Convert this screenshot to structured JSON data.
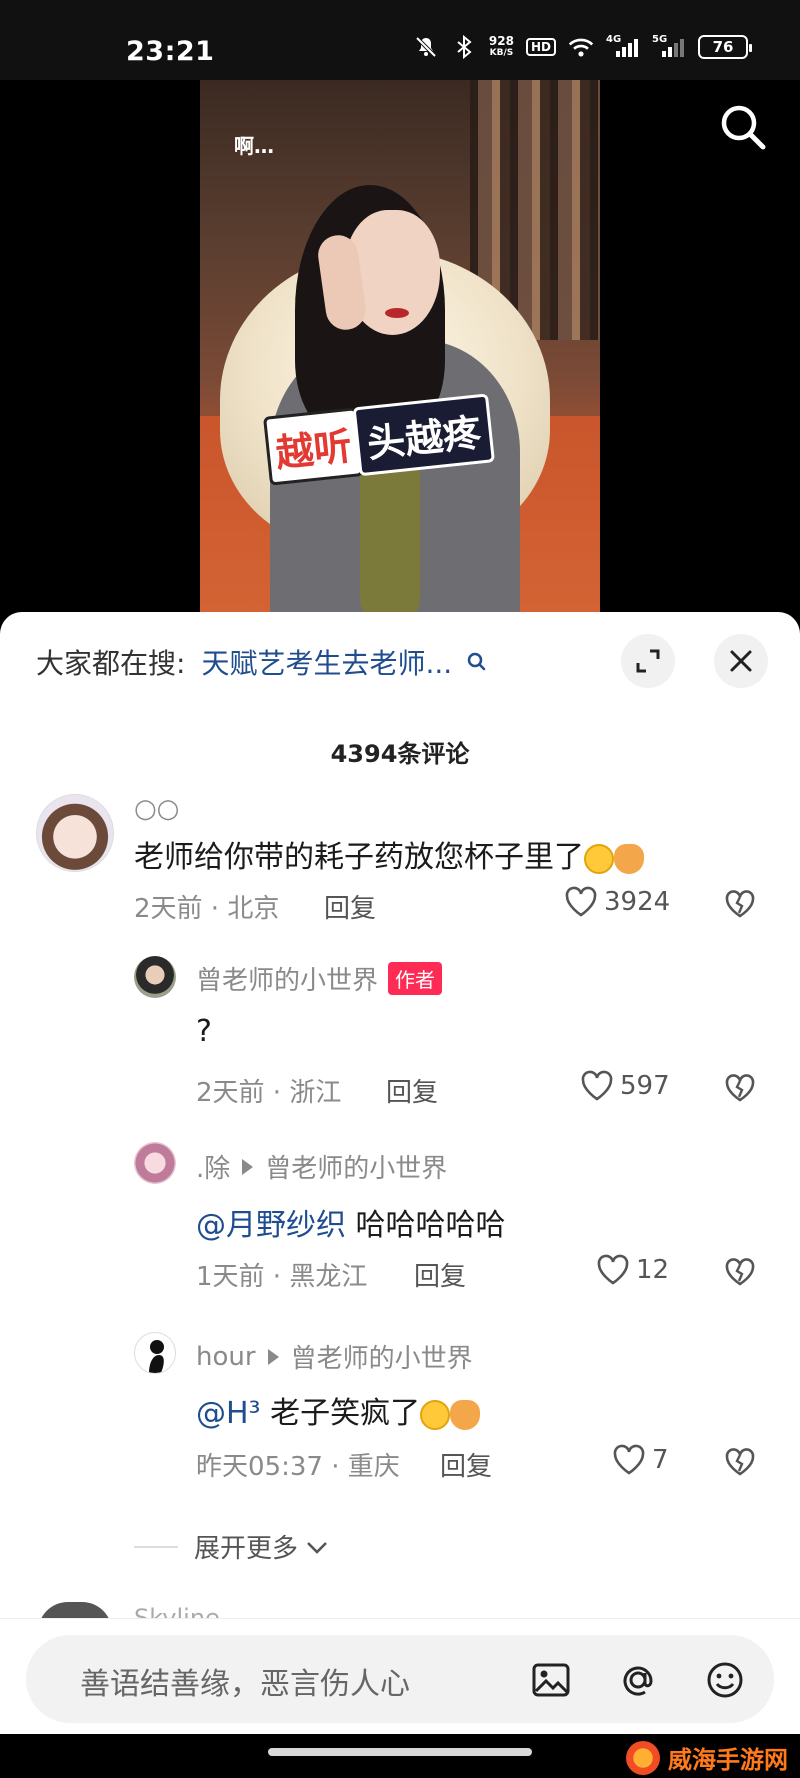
{
  "status_bar": {
    "time": "23:21",
    "net_speed_value": "928",
    "net_speed_unit": "KB/S",
    "hd_label": "HD",
    "signal1_label": "4G",
    "signal2_label": "5G",
    "battery": "76"
  },
  "video": {
    "side_text": "啊…",
    "caption_part1": "越听",
    "caption_part2": "头越疼"
  },
  "comments_panel": {
    "suggest_label": "大家都在搜:",
    "suggest_query": "天赋艺考生去老师...",
    "count_title": "4394条评论",
    "reply_label": "回复",
    "comments": [
      {
        "username": "○○",
        "text": "老师给你带的耗子药放您杯子里了",
        "time_location": "2天前 · 北京",
        "likes": "3924"
      },
      {
        "username": "曾老师的小世界",
        "badge": "作者",
        "text": "?",
        "time_location": "2天前 · 浙江",
        "likes": "597"
      },
      {
        "username": ".除",
        "reply_to": "曾老师的小世界",
        "mention": "@月野纱织",
        "text": " 哈哈哈哈哈",
        "time_location": "1天前 · 黑龙江",
        "likes": "12"
      },
      {
        "username": "hour",
        "reply_to": "曾老师的小世界",
        "mention": "@H³",
        "text": " 老子笑疯了",
        "time_location": "昨天05:37 · 重庆",
        "likes": "7"
      }
    ],
    "expand_more": "展开更多",
    "next_username_peek": "Skyline"
  },
  "input_bar": {
    "placeholder": "善语结善缘，恶言伤人心"
  },
  "watermark": {
    "text": "威海手游网"
  },
  "colors": {
    "mention_blue": "#1f4d8f",
    "author_badge": "#fe2c55",
    "watermark_orange": "#ff7a1a"
  }
}
